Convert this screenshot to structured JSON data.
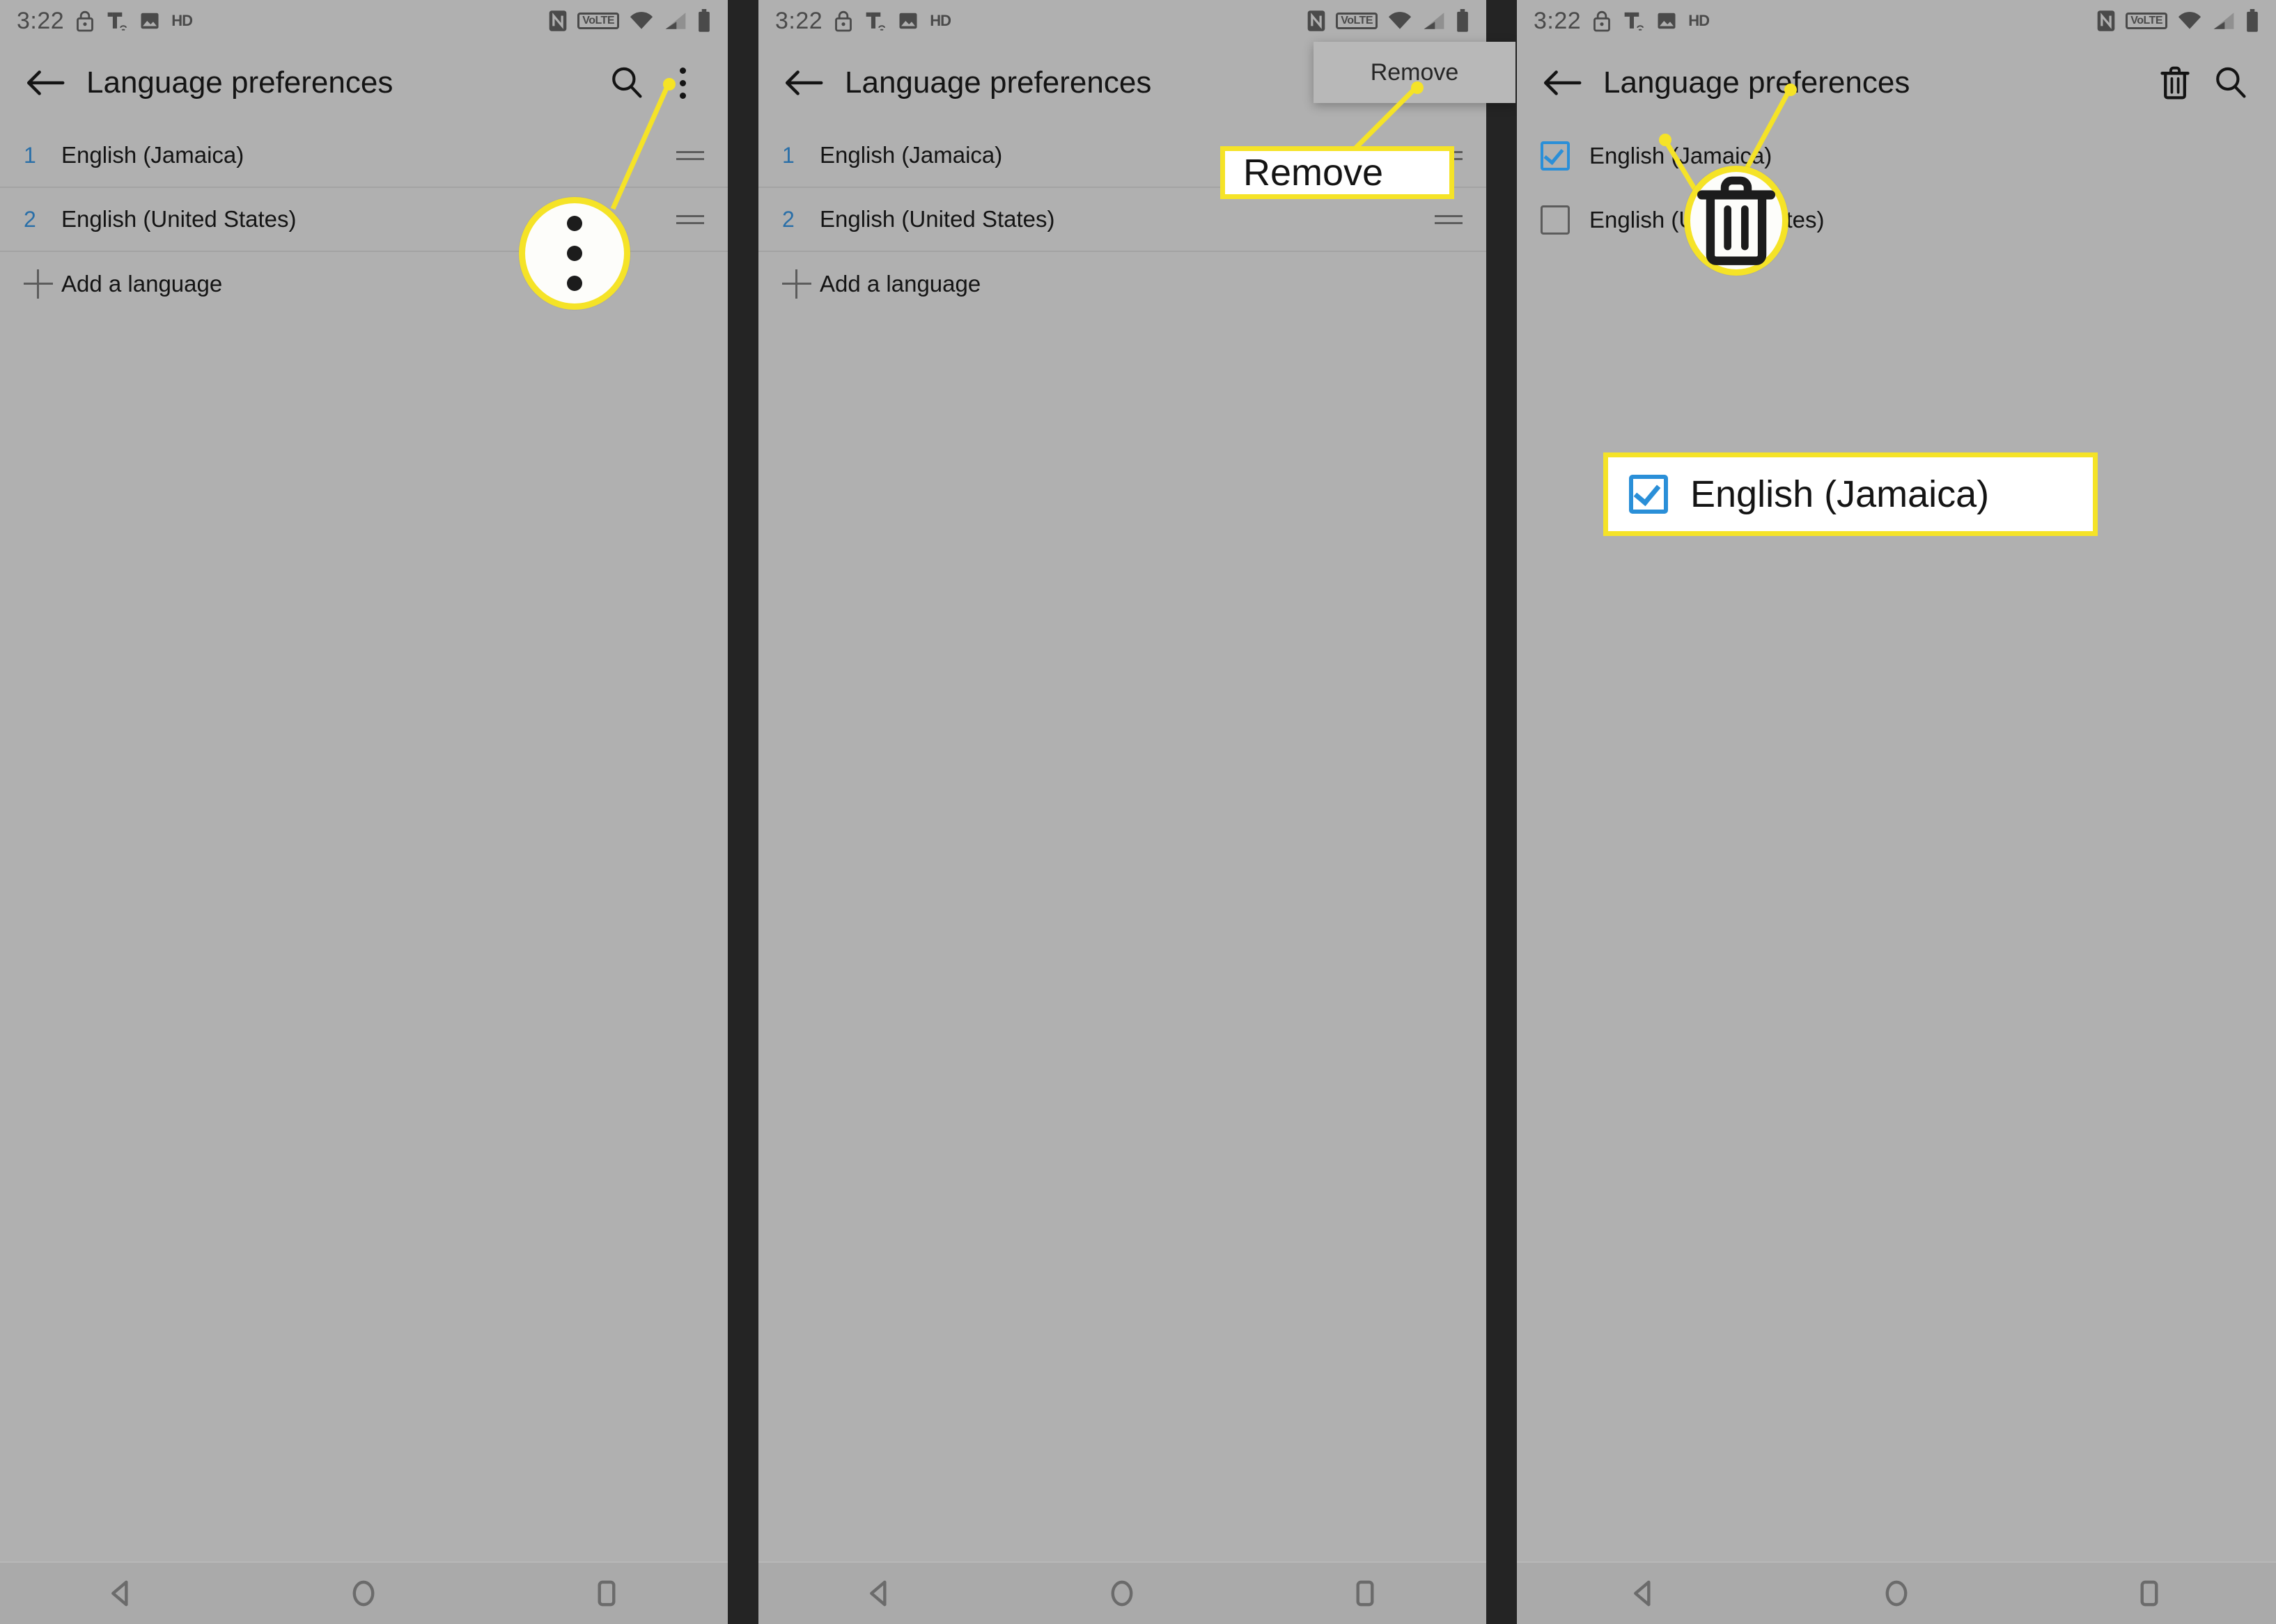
{
  "meta": {
    "screen_title": "Language preferences",
    "accent_blue": "#2a8fd8",
    "highlight_yellow": "#f5e327",
    "panel_bg": "#b0b0b0",
    "divider_dark": "#242424"
  },
  "status_bar": {
    "time": "3:22",
    "left_icons": [
      "lock-icon",
      "tmobile-icon",
      "screenshot-icon",
      "hd-icon"
    ],
    "hd_label": "HD",
    "right_icons": [
      "nfc-icon",
      "volte-icon",
      "wifi-icon",
      "cellular-signal-icon",
      "battery-icon"
    ],
    "volte_label": "VoLTE"
  },
  "panels": [
    {
      "id": "panel-1",
      "appbar": {
        "title": "Language preferences",
        "back_icon": "back-arrow-icon",
        "actions": [
          "search-icon",
          "overflow-menu-icon"
        ]
      },
      "languages": [
        {
          "num": "1",
          "label": "English (Jamaica)"
        },
        {
          "num": "2",
          "label": "English (United States)"
        }
      ],
      "add_language_label": "Add a language",
      "annotation": {
        "type": "magnifier",
        "target": "overflow-menu-icon",
        "magnified_icon": "overflow-menu-icon"
      }
    },
    {
      "id": "panel-2",
      "appbar": {
        "title": "Language preferences",
        "back_icon": "back-arrow-icon",
        "actions": []
      },
      "popup_menu": {
        "items": [
          "Remove"
        ]
      },
      "languages": [
        {
          "num": "1",
          "label": "English (Jamaica)"
        },
        {
          "num": "2",
          "label": "English (United States)"
        }
      ],
      "add_language_label": "Add a language",
      "annotation": {
        "type": "callout",
        "text": "Remove",
        "target": "popup-menu-item-remove"
      }
    },
    {
      "id": "panel-3",
      "appbar": {
        "title": "Language preferences",
        "back_icon": "back-arrow-icon",
        "actions": [
          "delete-icon",
          "search-icon"
        ]
      },
      "checkbox_items": [
        {
          "label": "English (Jamaica)",
          "checked": true
        },
        {
          "label": "English (United States)",
          "checked": false
        }
      ],
      "annotations": [
        {
          "type": "magnifier",
          "target": "delete-icon",
          "magnified_icon": "trash-icon"
        },
        {
          "type": "callout",
          "text": "English (Jamaica)",
          "checked": true,
          "target": "checkbox-english-jamaica"
        }
      ]
    }
  ],
  "nav_bar": {
    "buttons": [
      "back-triangle-icon",
      "home-circle-icon",
      "recents-square-icon"
    ]
  }
}
